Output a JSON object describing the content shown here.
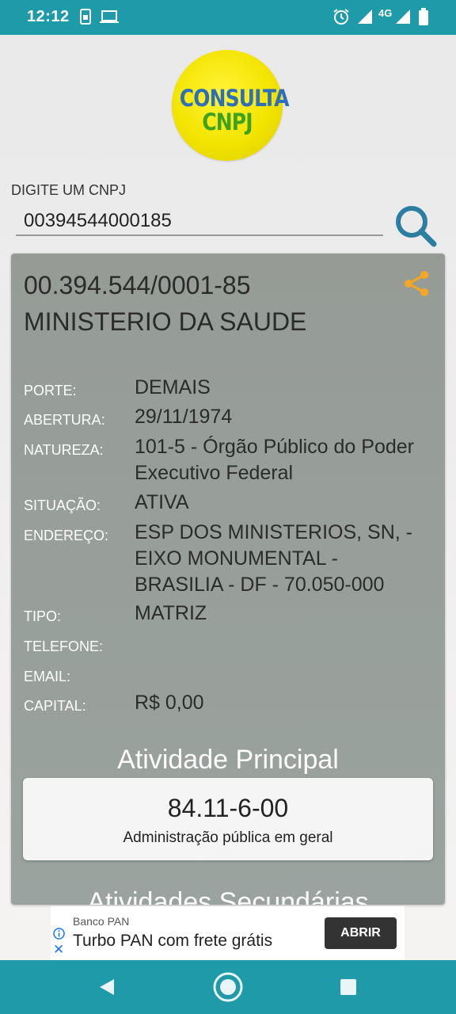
{
  "status_bar": {
    "time": "12:12",
    "network": "4G",
    "icons": [
      "sim-card-icon",
      "laptop-icon",
      "alarm-icon",
      "signal-icon",
      "battery-icon"
    ]
  },
  "logo": {
    "line1": "CONSULTA",
    "line2": "CNPJ"
  },
  "search": {
    "label": "DIGITE UM CNPJ",
    "value": "00394544000185",
    "icon": "search-icon"
  },
  "result": {
    "cnpj": "00.394.544/0001-85",
    "name": "MINISTERIO DA SAUDE",
    "fields": [
      {
        "label": "PORTE:",
        "value": "DEMAIS"
      },
      {
        "label": "ABERTURA:",
        "value": "29/11/1974"
      },
      {
        "label": "NATUREZA:",
        "value": "101-5 - Órgão Público do Poder Executivo Federal"
      },
      {
        "label": "SITUAÇÃO:",
        "value": "ATIVA"
      },
      {
        "label": "ENDEREÇO:",
        "value": "ESP DOS MINISTERIOS, SN,  - EIXO MONUMENTAL - BRASILIA - DF - 70.050-000"
      },
      {
        "label": "TIPO:",
        "value": "MATRIZ"
      },
      {
        "label": "TELEFONE:",
        "value": ""
      },
      {
        "label": "EMAIL:",
        "value": ""
      },
      {
        "label": "CAPITAL:",
        "value": "R$ 0,00"
      }
    ],
    "main_activity_title": "Atividade Principal",
    "main_activity": {
      "code": "84.11-6-00",
      "description": "Administração pública em geral"
    },
    "secondary_activities_title": "Atividades Secundárias"
  },
  "ad": {
    "sponsor": "Banco PAN",
    "title": "Turbo PAN com frete grátis",
    "button": "ABRIR"
  },
  "colors": {
    "teal_bar": "#1f9aa9",
    "share_orange": "#f5a623",
    "search_blue": "#2b7ea0",
    "card_gray": "#979c97"
  }
}
